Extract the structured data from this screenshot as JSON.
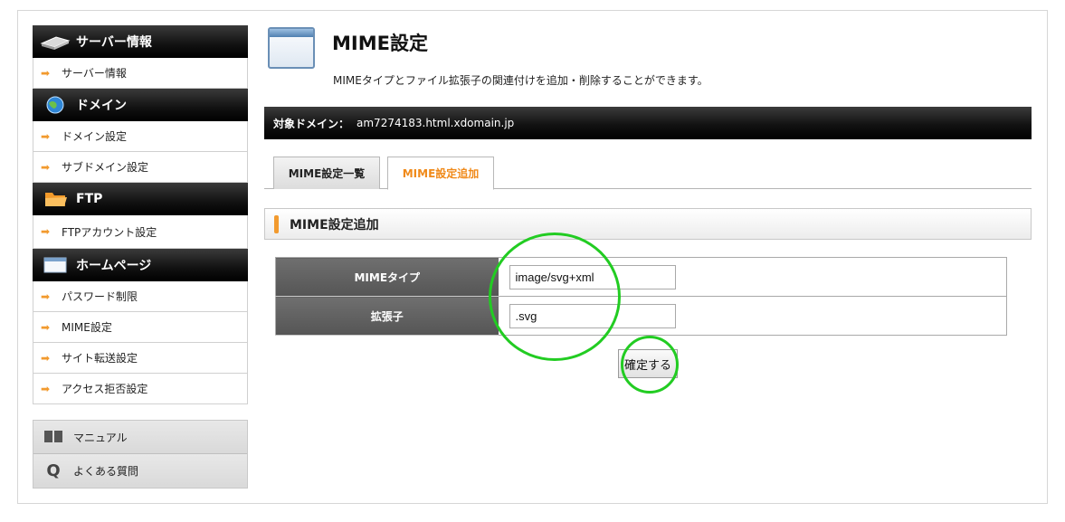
{
  "sidebar": {
    "sections": [
      {
        "heading": "サーバー情報",
        "icon": "server-icon",
        "items": [
          "サーバー情報"
        ]
      },
      {
        "heading": "ドメイン",
        "icon": "globe-icon",
        "items": [
          "ドメイン設定",
          "サブドメイン設定"
        ]
      },
      {
        "heading": "FTP",
        "icon": "folder-icon",
        "items": [
          "FTPアカウント設定"
        ]
      },
      {
        "heading": "ホームページ",
        "icon": "window-icon",
        "items": [
          "パスワード制限",
          "MIME設定",
          "サイト転送設定",
          "アクセス拒否設定"
        ]
      }
    ],
    "extras": [
      {
        "label": "マニュアル",
        "icon": "book-icon"
      },
      {
        "label": "よくある質問",
        "icon": "q-icon"
      }
    ]
  },
  "header": {
    "title": "MIME設定",
    "description": "MIMEタイプとファイル拡張子の関連付けを追加・削除することができます。",
    "icon": "window-icon"
  },
  "domain_bar": {
    "label": "対象ドメイン：",
    "value": "am7274183.html.xdomain.jp"
  },
  "tabs": {
    "list": "MIME設定一覧",
    "add": "MIME設定追加",
    "active": "MIME設定追加"
  },
  "section": {
    "title": "MIME設定追加"
  },
  "form": {
    "mime_type_label": "MIMEタイプ",
    "mime_type_value": "image/svg+xml",
    "extension_label": "拡張子",
    "extension_value": ".svg",
    "submit_label": "確定する"
  },
  "colors": {
    "accent": "#f29a2e",
    "annotation": "#22cc22"
  }
}
